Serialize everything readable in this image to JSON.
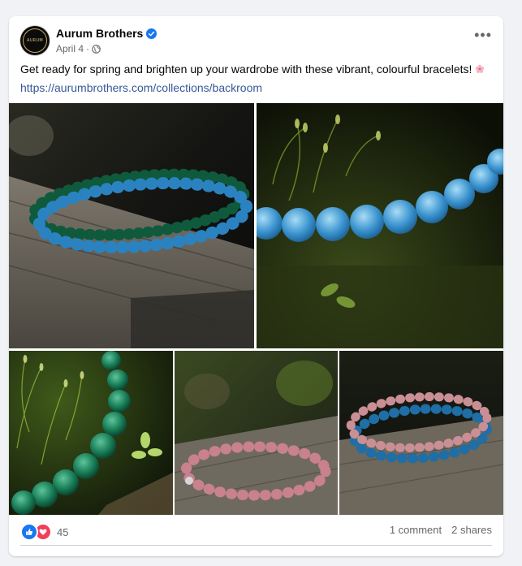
{
  "post": {
    "page_name": "Aurum Brothers",
    "avatar_text": "AURUM",
    "date": "April 4",
    "separator": "·",
    "more_label": "•••",
    "caption": "Get ready for spring and brighten up your wardrobe with these vibrant, colourful bracelets!",
    "link": "https://aurumbrothers.com/collections/backroom"
  },
  "footer": {
    "reaction_count": "45",
    "comments": "1 comment",
    "shares": "2 shares"
  },
  "photos": [
    {
      "name": "photo-green-blue-bracelets"
    },
    {
      "name": "photo-blue-bead-bracelet-moss"
    },
    {
      "name": "photo-green-bracelet-moss"
    },
    {
      "name": "photo-pink-bracelet"
    },
    {
      "name": "photo-pink-blue-bracelets"
    }
  ],
  "colors": {
    "link": "#385898",
    "like": "#1877f2",
    "love": "#f33e58",
    "verified": "#1877f2"
  }
}
